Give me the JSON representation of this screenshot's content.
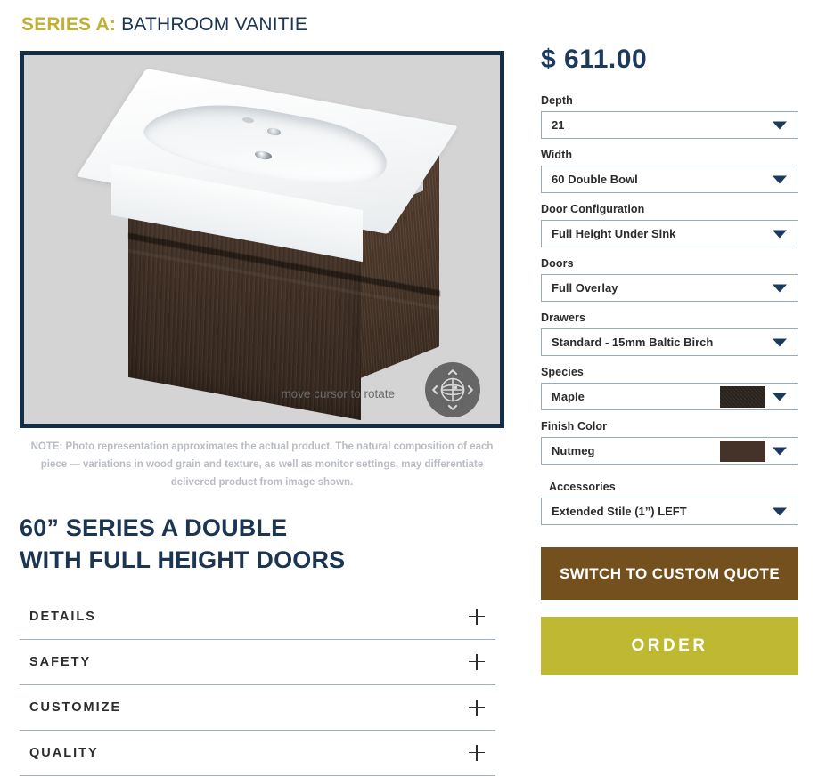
{
  "header": {
    "series_label": "SERIES A:",
    "series_name": "BATHROOM VANITIE"
  },
  "viewer": {
    "rotate_hint": "move cursor to rotate",
    "rotate_icon": "rotate-sphere-icon",
    "border_color": "#152e47",
    "background_color": "#d4d4d4"
  },
  "note": "NOTE: Photo representation approximates the actual product. The natural composition of each piece — variations in wood grain and texture, as well as monitor settings, may differentiate delivered product from image shown.",
  "product": {
    "title_line1": "60” SERIES A DOUBLE",
    "title_line2": "WITH FULL HEIGHT DOORS"
  },
  "accordion": {
    "items": [
      {
        "label": "DETAILS",
        "icon": "plus-icon"
      },
      {
        "label": "SAFETY",
        "icon": "plus-icon"
      },
      {
        "label": "CUSTOMIZE",
        "icon": "plus-icon"
      },
      {
        "label": "QUALITY",
        "icon": "plus-icon"
      }
    ]
  },
  "configurator": {
    "price": "$ 611.00",
    "fields": [
      {
        "label": "Depth",
        "value": "21"
      },
      {
        "label": "Width",
        "value": "60   Double Bowl"
      },
      {
        "label": "Door Configuration",
        "value": "Full Height Under Sink"
      },
      {
        "label": "Doors",
        "value": "Full Overlay"
      },
      {
        "label": "Drawers",
        "value": "Standard - 15mm Baltic Birch"
      },
      {
        "label": "Species",
        "value": "Maple",
        "swatch": "#2e2620"
      },
      {
        "label": "Finish Color",
        "value": "Nutmeg",
        "swatch": "#45332a"
      },
      {
        "label": "Accessories",
        "value": "Extended Stile (1”) LEFT"
      }
    ],
    "quote_button": "SWITCH TO CUSTOM QUOTE",
    "order_button": "ORDER",
    "colors": {
      "price": "#1b3a5e",
      "quote_button": "#74501e",
      "order_button": "#bfb833",
      "accent_gold": "#bfb133",
      "navy": "#1c3553"
    }
  }
}
